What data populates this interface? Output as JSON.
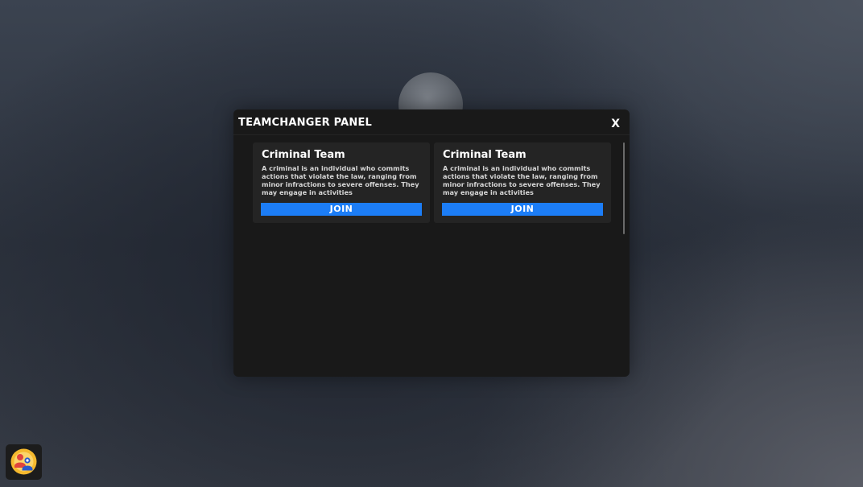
{
  "panel": {
    "title": "TEAMCHANGER PANEL",
    "close_label": "X"
  },
  "teams": [
    {
      "name": "Criminal Team",
      "description": "A criminal is an individual who commits actions that violate the law, ranging from minor infractions to severe offenses. They may engage in activities",
      "join_label": "JOIN"
    },
    {
      "name": "Criminal Team",
      "description": "A criminal is an individual who commits actions that violate the law, ranging from minor infractions to severe offenses. They may engage in activities",
      "join_label": "JOIN"
    }
  ],
  "corner_button": {
    "icon": "team-users-icon"
  },
  "colors": {
    "accent": "#1c7df6",
    "panel_bg": "#191919",
    "card_bg": "#242424",
    "icon_bg": "#f5b92e"
  }
}
